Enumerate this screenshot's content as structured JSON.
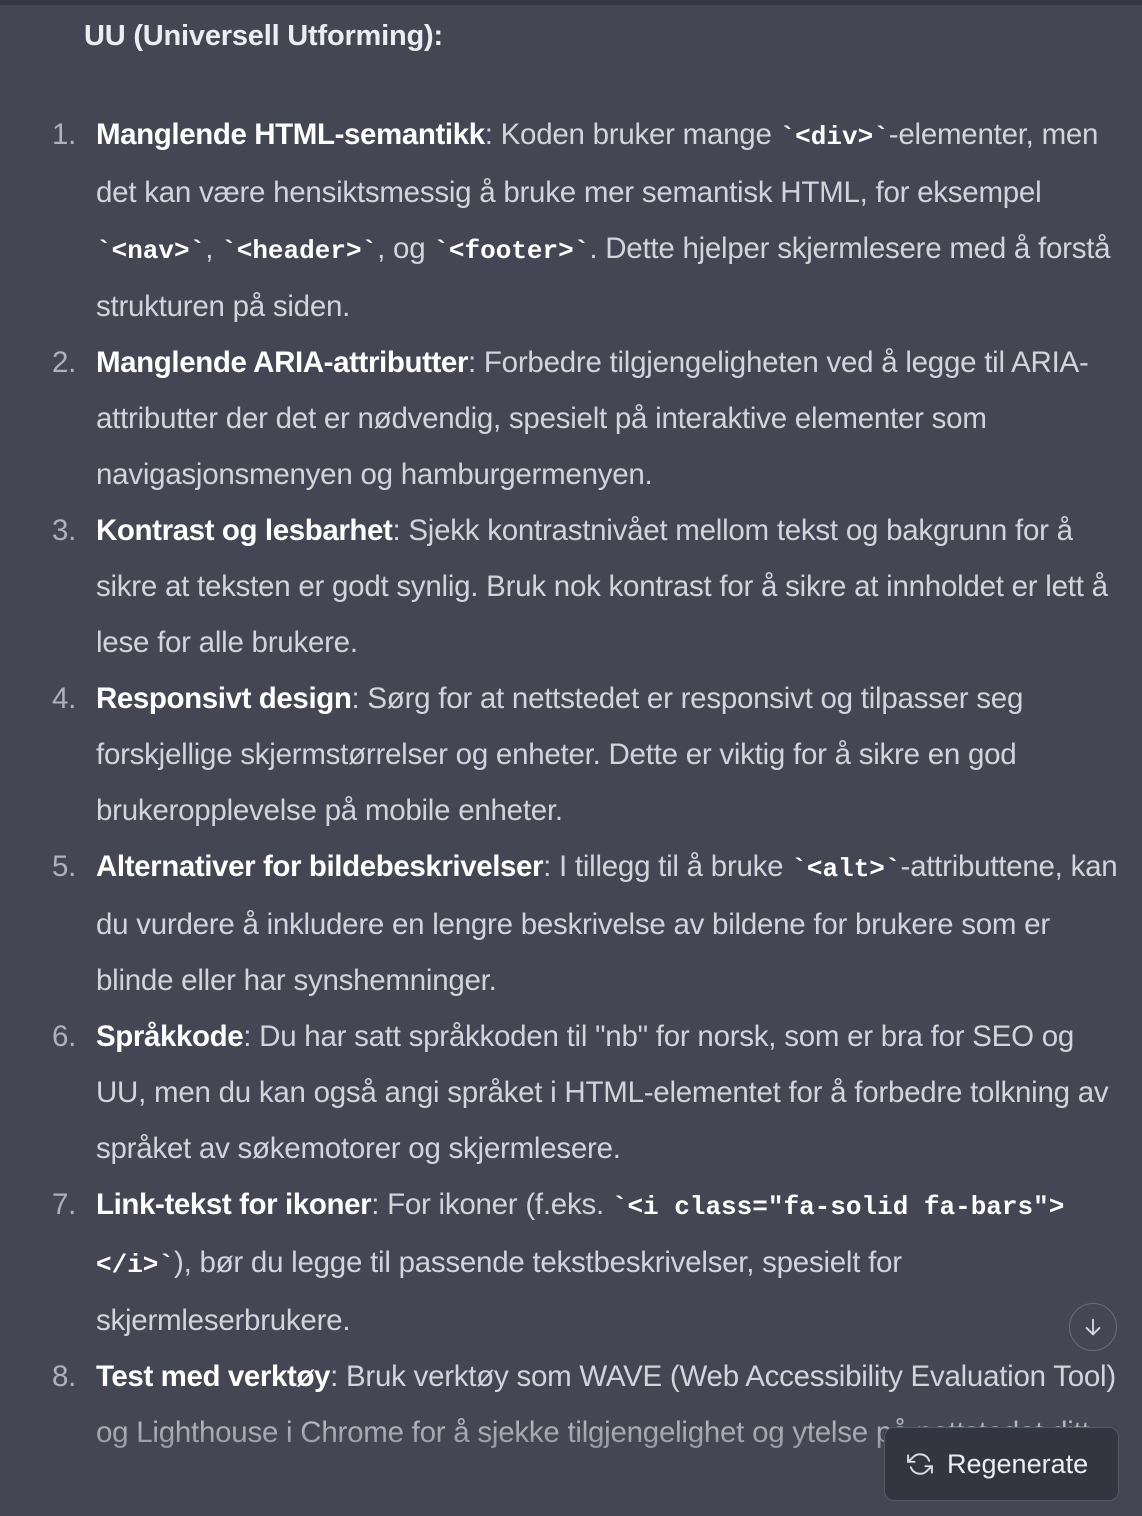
{
  "heading": "UU (Universell Utforming):",
  "items": [
    {
      "number": "1.",
      "segments": [
        {
          "t": "b",
          "v": "Manglende HTML-semantikk"
        },
        {
          "t": "n",
          "v": ": Koden bruker mange "
        },
        {
          "t": "c",
          "v": "`<div>`"
        },
        {
          "t": "n",
          "v": "-elementer, men det kan være hensiktsmessig å bruke mer semantisk HTML, for eksempel "
        },
        {
          "t": "c",
          "v": "`<nav>`"
        },
        {
          "t": "n",
          "v": ", "
        },
        {
          "t": "c",
          "v": "`<header>`"
        },
        {
          "t": "n",
          "v": ", og "
        },
        {
          "t": "c",
          "v": "`<footer>`"
        },
        {
          "t": "n",
          "v": ". Dette hjelper skjermlesere med å forstå strukturen på siden."
        }
      ]
    },
    {
      "number": "2.",
      "segments": [
        {
          "t": "b",
          "v": "Manglende ARIA-attributter"
        },
        {
          "t": "n",
          "v": ": Forbedre tilgjengeligheten ved å legge til ARIA-attributter der det er nødvendig, spesielt på interaktive elementer som navigasjonsmenyen og hamburgermenyen."
        }
      ]
    },
    {
      "number": "3.",
      "segments": [
        {
          "t": "b",
          "v": "Kontrast og lesbarhet"
        },
        {
          "t": "n",
          "v": ": Sjekk kontrastnivået mellom tekst og bakgrunn for å sikre at teksten er godt synlig. Bruk nok kontrast for å sikre at innholdet er lett å lese for alle brukere."
        }
      ]
    },
    {
      "number": "4.",
      "segments": [
        {
          "t": "b",
          "v": "Responsivt design"
        },
        {
          "t": "n",
          "v": ": Sørg for at nettstedet er responsivt og tilpasser seg forskjellige skjermstørrelser og enheter. Dette er viktig for å sikre en god brukeropplevelse på mobile enheter."
        }
      ]
    },
    {
      "number": "5.",
      "segments": [
        {
          "t": "b",
          "v": "Alternativer for bildebeskrivelser"
        },
        {
          "t": "n",
          "v": ": I tillegg til å bruke "
        },
        {
          "t": "c",
          "v": "`<alt>`"
        },
        {
          "t": "n",
          "v": "-attributtene, kan du vurdere å inkludere en lengre beskrivelse av bildene for brukere som er blinde eller har synshemninger."
        }
      ]
    },
    {
      "number": "6.",
      "segments": [
        {
          "t": "b",
          "v": "Språkkode"
        },
        {
          "t": "n",
          "v": ": Du har satt språkkoden til \"nb\" for norsk, som er bra for SEO og UU, men du kan også angi språket i HTML-elementet for å forbedre tolkning av språket av søkemotorer og skjermlesere."
        }
      ]
    },
    {
      "number": "7.",
      "segments": [
        {
          "t": "b",
          "v": "Link-tekst for ikoner"
        },
        {
          "t": "n",
          "v": ": For ikoner (f.eks. "
        },
        {
          "t": "c",
          "v": "`<i class=\"fa-solid fa-bars\"></i>`"
        },
        {
          "t": "n",
          "v": "), bør du legge til passende tekstbeskrivelser, spesielt for skjermleserbrukere."
        }
      ]
    },
    {
      "number": "8.",
      "segments": [
        {
          "t": "b",
          "v": "Test med verktøy"
        },
        {
          "t": "n",
          "v": ": Bruk verktøy som WAVE (Web Accessibility Evaluation Tool) og Lighthouse i Chrome for å sjekke tilgjengelighet og ytelse på nettstedet ditt."
        }
      ]
    }
  ],
  "scroll_button": {
    "icon": "arrow-down-icon"
  },
  "regenerate_button": {
    "label": "Regenerate",
    "icon": "refresh-icon"
  }
}
